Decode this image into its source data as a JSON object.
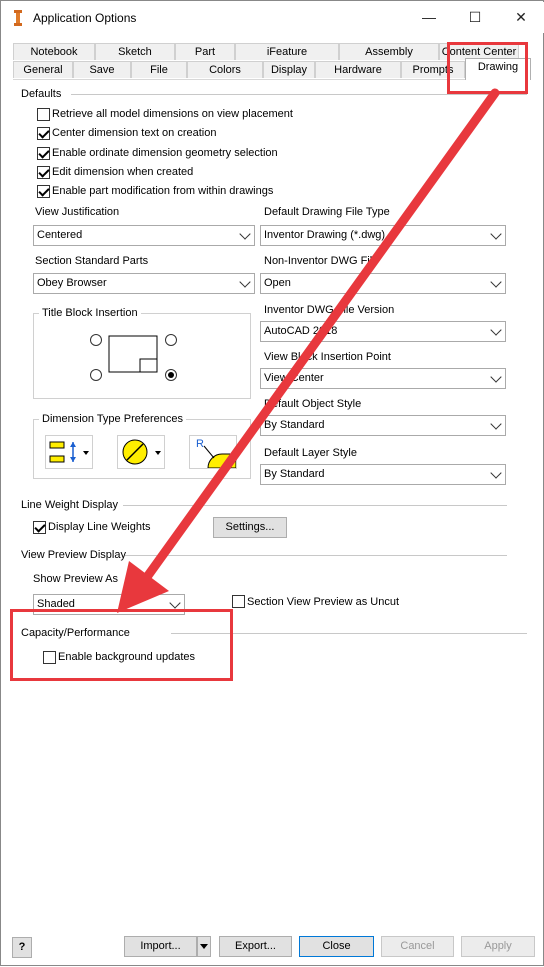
{
  "window": {
    "title": "Application Options",
    "minimize": "—",
    "maximize": "☐",
    "close": "✕"
  },
  "tabs_top": [
    "Notebook",
    "Sketch",
    "Part",
    "iFeature",
    "Assembly",
    "Content Center"
  ],
  "tabs_bottom": [
    "General",
    "Save",
    "File",
    "Colors",
    "Display",
    "Hardware",
    "Prompts",
    "Drawing"
  ],
  "defaults": {
    "label": "Defaults",
    "checkboxes": [
      {
        "label": "Retrieve all model dimensions on view placement",
        "checked": false
      },
      {
        "label": "Center dimension text on creation",
        "checked": true
      },
      {
        "label": "Enable ordinate dimension geometry selection",
        "checked": true
      },
      {
        "label": "Edit dimension when created",
        "checked": true
      },
      {
        "label": "Enable part modification from within drawings",
        "checked": true
      }
    ],
    "view_justification": {
      "label": "View Justification",
      "value": "Centered"
    },
    "default_drawing_file_type": {
      "label": "Default Drawing File Type",
      "value": "Inventor Drawing (*.dwg)"
    },
    "section_standard_parts": {
      "label": "Section Standard Parts",
      "value": "Obey Browser"
    },
    "non_inventor_dwg": {
      "label": "Non-Inventor DWG File",
      "value": "Open"
    },
    "title_block_insertion": {
      "label": "Title Block Insertion"
    },
    "inventor_dwg_version": {
      "label": "Inventor DWG File Version",
      "value": "AutoCAD 2018"
    },
    "view_block_insertion_point": {
      "label": "View Block Insertion Point",
      "value": "View Center"
    },
    "dimension_type_preferences": {
      "label": "Dimension Type Preferences"
    },
    "default_object_style": {
      "label": "Default Object Style",
      "value": "By Standard"
    },
    "default_layer_style": {
      "label": "Default Layer Style",
      "value": "By Standard"
    }
  },
  "line_weight": {
    "label": "Line Weight Display",
    "checkbox": "Display Line Weights",
    "checked": true,
    "settings_button": "Settings..."
  },
  "view_preview": {
    "label": "View Preview Display",
    "show_label": "Show Preview As",
    "value": "Shaded",
    "section_checkbox": "Section View Preview as Uncut",
    "section_checked": false
  },
  "capacity": {
    "label": "Capacity/Performance",
    "checkbox": "Enable background updates",
    "checked": false
  },
  "footer": {
    "help": "?",
    "import": "Import...",
    "export": "Export...",
    "close": "Close",
    "cancel": "Cancel",
    "apply": "Apply"
  },
  "colors": {
    "annotation": "#e8383d",
    "accent": "#0078d7",
    "icon_yellow": "#ffee00"
  }
}
